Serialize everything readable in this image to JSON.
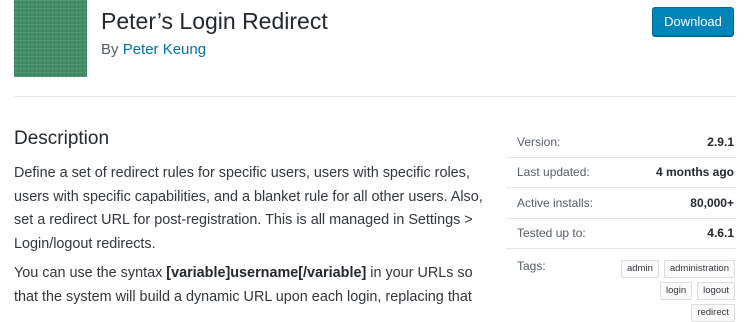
{
  "plugin": {
    "title": "Peter’s Login Redirect",
    "by_label": "By",
    "author": "Peter Keung",
    "download_label": "Download"
  },
  "description": {
    "heading": "Description",
    "p1": "Define a set of redirect rules for specific users, users with specific roles, users with specific capabilities, and a blanket rule for all other users. Also, set a redirect URL for post-registration. This is all managed in Settings > Login/logout redirects.",
    "p2_before": "You can use the syntax ",
    "p2_bold": "[variable]username[/variable]",
    "p2_after": " in your URLs so that the system will build a dynamic URL upon each login, replacing that"
  },
  "meta": {
    "version_label": "Version:",
    "version": "2.9.1",
    "updated_label": "Last updated:",
    "updated": "4 months ago",
    "installs_label": "Active installs:",
    "installs": "80,000+",
    "tested_label": "Tested up to:",
    "tested": "4.6.1",
    "tags_label": "Tags:",
    "tags": [
      "admin",
      "administration",
      "login",
      "logout",
      "redirect"
    ]
  },
  "colors": {
    "accent": "#0085ba",
    "link": "#0073aa",
    "icon_green": "#3f8f67"
  }
}
